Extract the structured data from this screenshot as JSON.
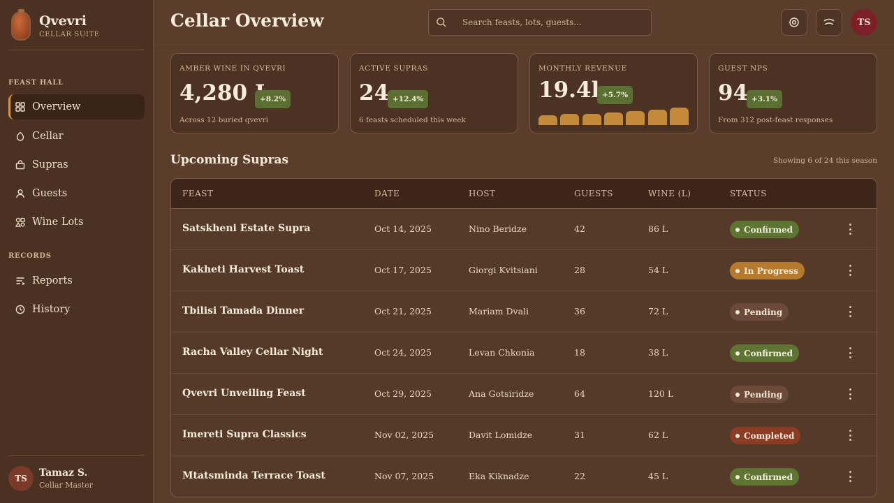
{
  "brand": {
    "name": "Qvevri",
    "subtitle": "CELLAR SUITE"
  },
  "sidebar": {
    "sections": [
      {
        "label": "FEAST HALL"
      },
      {
        "label": "RECORDS"
      }
    ],
    "items": [
      {
        "label": "Overview",
        "icon": "grid-icon",
        "active": true
      },
      {
        "label": "Cellar",
        "icon": "drop-icon"
      },
      {
        "label": "Supras",
        "icon": "bag-icon"
      },
      {
        "label": "Guests",
        "icon": "user-icon"
      },
      {
        "label": "Wine Lots",
        "icon": "shapes-icon"
      },
      {
        "label": "Reports",
        "icon": "list-icon"
      },
      {
        "label": "History",
        "icon": "clock-icon"
      }
    ],
    "user": {
      "initials": "TS",
      "name": "Tamaz S.",
      "role": "Cellar Master"
    }
  },
  "header": {
    "title": "Cellar Overview",
    "search_placeholder": "Search feasts, lots, guests...",
    "avatar_initials": "TS"
  },
  "stats": [
    {
      "label": "AMBER WINE IN QVEVRI",
      "value": "4,280 L",
      "delta": "+8.2%",
      "note": "Across 12 buried qvevri"
    },
    {
      "label": "ACTIVE SUPRAS",
      "value": "24",
      "delta": "+12.4%",
      "note": "6 feasts scheduled this week"
    },
    {
      "label": "MONTHLY REVENUE",
      "value": "19.4k",
      "delta": "+5.7%",
      "trend": [
        0.55,
        0.62,
        0.6,
        0.7,
        0.78,
        0.86,
        0.95
      ]
    },
    {
      "label": "GUEST NPS",
      "value": "94",
      "delta": "+3.1%",
      "note": "From 312 post-feast responses"
    }
  ],
  "table": {
    "title": "Upcoming Supras",
    "meta": "Showing 6 of 24 this season",
    "columns": [
      "FEAST",
      "DATE",
      "HOST",
      "GUESTS",
      "WINE (L)",
      "STATUS"
    ],
    "rows": [
      {
        "feast": "Satskheni Estate Supra",
        "date": "Oct 14, 2025",
        "host": "Nino Beridze",
        "guests": "42",
        "wine": "86 L",
        "status": "Confirmed",
        "status_type": "confirmed"
      },
      {
        "feast": "Kakheti Harvest Toast",
        "date": "Oct 17, 2025",
        "host": "Giorgi Kvitsiani",
        "guests": "28",
        "wine": "54 L",
        "status": "In Progress",
        "status_type": "progress"
      },
      {
        "feast": "Tbilisi Tamada Dinner",
        "date": "Oct 21, 2025",
        "host": "Mariam Dvali",
        "guests": "36",
        "wine": "72 L",
        "status": "Pending",
        "status_type": "pending"
      },
      {
        "feast": "Racha Valley Cellar Night",
        "date": "Oct 24, 2025",
        "host": "Levan Chkonia",
        "guests": "18",
        "wine": "38 L",
        "status": "Confirmed",
        "status_type": "confirmed"
      },
      {
        "feast": "Qvevri Unveiling Feast",
        "date": "Oct 29, 2025",
        "host": "Ana Gotsiridze",
        "guests": "64",
        "wine": "120 L",
        "status": "Pending",
        "status_type": "pending"
      },
      {
        "feast": "Imereti Supra Classics",
        "date": "Nov 02, 2025",
        "host": "Davit Lomidze",
        "guests": "31",
        "wine": "62 L",
        "status": "Completed",
        "status_type": "completed"
      },
      {
        "feast": "Mtatsminda Terrace Toast",
        "date": "Nov 07, 2025",
        "host": "Eka Kiknadze",
        "guests": "22",
        "wine": "45 L",
        "status": "Confirmed",
        "status_type": "confirmed"
      }
    ]
  }
}
